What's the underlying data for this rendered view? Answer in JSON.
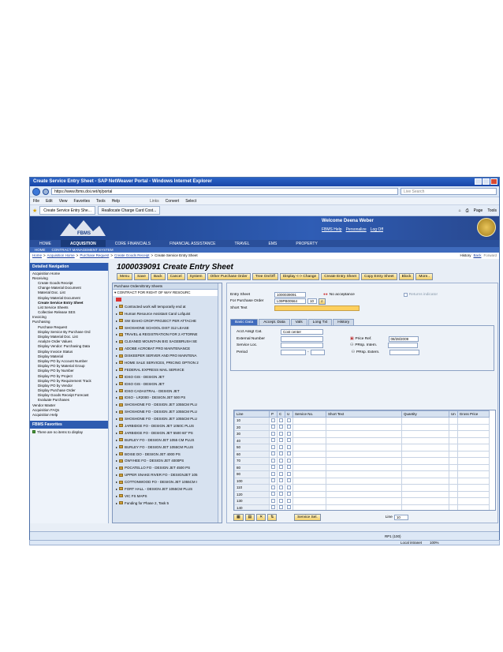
{
  "browser": {
    "title": "Create Service Entry Sheet - SAP NetWeaver Portal - Windows Internet Explorer",
    "url": "https://www.fbms.doi.net/irj/portal",
    "search_placeholder": "Live Search",
    "menu": [
      "File",
      "Edit",
      "View",
      "Favorites",
      "Tools",
      "Help"
    ],
    "links_label": "Links",
    "convert_label": "Convert",
    "select_label": "Select",
    "tabs": [
      "Create Service Entry She...",
      "Reallocate Charge Card Cost..."
    ],
    "page_label": "Page",
    "tools_label": "Tools",
    "status_zone": "Local intranet",
    "zoom": "100%"
  },
  "portal": {
    "logo_text": "FBMS",
    "welcome": "Welcome Deena Weber",
    "top_links": [
      "FBMS Help",
      "Personalize",
      "Log Off"
    ],
    "main_nav": [
      "HOME",
      "ACQUISITION",
      "CORE FINANCIALS",
      "FINANCIAL ASSISTANCE",
      "TRAVEL",
      "EMS",
      "PROPERTY"
    ],
    "sub_nav": [
      "HOME",
      "CONTRACT MANAGEMENT SYSTEM"
    ],
    "breadcrumbs": [
      "Home",
      "Acquisition Home",
      "Purchase Request",
      "Create Goods Receipt",
      "Create Service Entry Sheet"
    ],
    "history": [
      "History",
      "Back",
      "Forward"
    ]
  },
  "leftnav": {
    "header": "Detailed Navigation",
    "items": [
      {
        "label": "Acquisition Home",
        "level": 1
      },
      {
        "label": "Receiving",
        "level": 1
      },
      {
        "label": "Create Goods Receipt",
        "level": 2
      },
      {
        "label": "Change Material Document",
        "level": 2
      },
      {
        "label": "Material Doc. List",
        "level": 2
      },
      {
        "label": "Display Material Document",
        "level": 2
      },
      {
        "label": "Create Service Entry Sheet",
        "level": 2,
        "bold": true
      },
      {
        "label": "List Service Sheets",
        "level": 2
      },
      {
        "label": "Collective Release SES",
        "level": 2
      },
      {
        "label": "Invoicing",
        "level": 1
      },
      {
        "label": "Purchasing",
        "level": 1
      },
      {
        "label": "Purchase Request",
        "level": 2
      },
      {
        "label": "Display Service By Purchase Ord",
        "level": 2
      },
      {
        "label": "Display Material Doc. List",
        "level": 2
      },
      {
        "label": "Analyze Order Values",
        "level": 2
      },
      {
        "label": "Display Vendor: Purchasing Data",
        "level": 2
      },
      {
        "label": "Display Invoice Status",
        "level": 2
      },
      {
        "label": "Display Material",
        "level": 2
      },
      {
        "label": "Display PO by Account Number",
        "level": 2
      },
      {
        "label": "Display PO by Material Group",
        "level": 2
      },
      {
        "label": "Display PO by Number",
        "level": 2
      },
      {
        "label": "Display PO by Project",
        "level": 2
      },
      {
        "label": "Display PO by Requirement Track",
        "level": 2
      },
      {
        "label": "Display PO by Vendor",
        "level": 2
      },
      {
        "label": "Display Purchase Order",
        "level": 2
      },
      {
        "label": "Display Goods Receipt Forecast",
        "level": 2
      },
      {
        "label": "Evaluate Purchases",
        "level": 2
      },
      {
        "label": "Vendor Master",
        "level": 1
      },
      {
        "label": "Acquisition FAQs",
        "level": 1
      },
      {
        "label": "Acquisition Help",
        "level": 1
      }
    ],
    "favorites_header": "FBMS Favorites",
    "favorites_empty": "There are no items to display"
  },
  "sap": {
    "title": "1000039091 Create Entry Sheet",
    "toolbar": [
      "Menu",
      "Save",
      "Back",
      "Cancel",
      "System",
      "Other Purchase Order",
      "Tree On/Off",
      "Display <-> Change",
      "Create Entry Sheet",
      "Copy Entry Sheet",
      "Block",
      "More.."
    ],
    "tree_header": "Purchase Orders/Entry Sheets",
    "tree_root": "CONTRACT FOR RIGHT OF WAY RESOURC",
    "tree_items": [
      "Contracted work will temporarily end at",
      "Human Resource Assistant Carol Lofquist",
      "SW IDAHO CROP PROJECT PER ATTACHE",
      "SHOSHONE SCHOOL DIST 312 LEASE",
      "TRAVEL & REGISTRATION FOR 2 ATTORNE",
      "CLEANED MOUNTAIN BIG SAGEBRUSH SE",
      "ADOBE ACROBAT PRO MAINTENANCE",
      "DISKEEPER SERVER AND PRO MAINTENA",
      "HOME SALE SERVICES, PRICING OPTION 2",
      "FEDERAL EXPRESS MAIL SERVICE",
      "IDSO GIS - DESIGN JET",
      "IDSO GIS - DESIGN JET",
      "IDSO CADASTRAL - DESIGN JET",
      "IDSO - LR2000 - DESIGN JET 500 PS",
      "SHOSHONE FO - DESIGN JET 1055CM PLU",
      "SHOSHONE FO - DESIGN JET 1055CM PLU",
      "SHOSHONE FO - DESIGN JET 1055CM PLU",
      "JARBIDGE FO - DESIGN JET 1050C PLUS",
      "JARBIDGE FO - DESIGN JET 5500 60\" PS",
      "BURLEY FO - DESIGN JET 1055 CM PLUS",
      "BURLEY FO - DESIGN JET 1055CM PLUS",
      "BOISE DO - DESIGN JET 4000 PS",
      "OWYHEE FO - DESIGN JET 4000PS",
      "POCATELLO FO - DESIGN JET 4500 PS",
      "UPPER SNAKE RIVER FO - DESIGNJET 105",
      "COTTONWOOD FO - DESIGN JET 1055CM I",
      "FORT HALL - DESIGN JET 1055CM PLUS",
      "VIC FS MAPS",
      "Funding for Phase 2, Task 5"
    ],
    "header_fields": {
      "entry_sheet_label": "Entry Sheet",
      "entry_sheet_value": "1000039091",
      "no_acceptance": "No acceptance",
      "returns_indicator": "Returns indicator",
      "po_label": "For Purchase Order",
      "po_value": "L09PB00564",
      "po_item": "10",
      "short_text_label": "Short Text"
    },
    "sub_tabs": [
      "Basic Data",
      "Accept. Data",
      "Vals",
      "Long Txt",
      "History"
    ],
    "basic": {
      "acct_label": "Acct Assgt Cat.",
      "acct_value": "Cost center",
      "external_label": "External Number",
      "service_loc_label": "Service Loc.",
      "period_label": "Period",
      "price_ref_label": "Price Ref.",
      "price_ref_value": "08/28/2009",
      "prsp_intern_label": "PRsp. Intern.",
      "prsp_extern_label": "PRsp. Extern."
    },
    "grid": {
      "columns": [
        "Line",
        "P",
        "C",
        "U",
        "Service No.",
        "Short Text",
        "Quantity",
        "Un",
        "Gross Price"
      ],
      "lines": [
        "10",
        "20",
        "30",
        "40",
        "50",
        "60",
        "70",
        "80",
        "90",
        "100",
        "110",
        "120",
        "130",
        "140"
      ]
    },
    "service_sel_button": "Service Sel.",
    "line_label": "Line",
    "line_value": "10",
    "status_sys": "RP1 (100)"
  }
}
